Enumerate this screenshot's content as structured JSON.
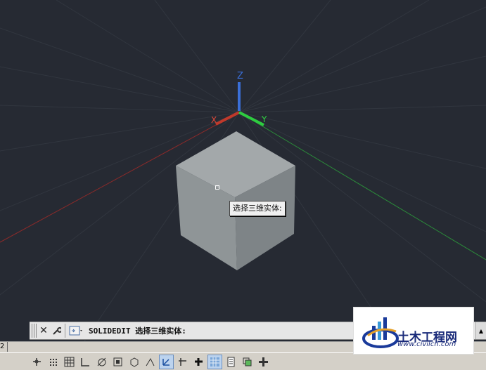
{
  "viewport": {
    "cursor_tooltip": "选择三维实体:",
    "axes": {
      "x_label": "X",
      "y_label": "Y",
      "z_label": "Z"
    }
  },
  "command_line": {
    "close_icon": "close-icon",
    "customize_icon": "wrench-icon",
    "recent_commands_icon": "command-prompt-icon",
    "text": "SOLIDEDIT 选择三维实体:"
  },
  "layout_tabs": {
    "current_fragment": "2"
  },
  "status_bar": {
    "toggles": [
      {
        "icon": "infer-constraints-icon",
        "on": false
      },
      {
        "icon": "snap-mode-icon",
        "on": false
      },
      {
        "icon": "grid-display-icon",
        "on": false
      },
      {
        "icon": "ortho-mode-icon",
        "on": false
      },
      {
        "icon": "polar-tracking-icon",
        "on": false
      },
      {
        "icon": "object-snap-icon",
        "on": false
      },
      {
        "icon": "3d-object-snap-icon",
        "on": false
      },
      {
        "icon": "object-snap-tracking-icon",
        "on": false
      },
      {
        "icon": "dynamic-ucs-icon",
        "on": true
      },
      {
        "icon": "dynamic-input-icon",
        "on": false
      },
      {
        "icon": "lineweight-icon",
        "on": false
      },
      {
        "icon": "transparency-icon",
        "on": true
      },
      {
        "icon": "quick-properties-icon",
        "on": false
      },
      {
        "icon": "selection-cycling-icon",
        "on": false
      },
      {
        "icon": "annotation-monitor-icon",
        "on": false
      }
    ]
  },
  "watermark": {
    "title": "土木工程网",
    "url": "www.civilcn.com"
  },
  "colors": {
    "background": "#262a33",
    "cube_top": "#a3a8aa",
    "cube_left": "#8f9597",
    "cube_right": "#7e8487",
    "x_axis": "#c0392b",
    "y_axis": "#2ecc40",
    "z_axis": "#3a6fd8"
  }
}
